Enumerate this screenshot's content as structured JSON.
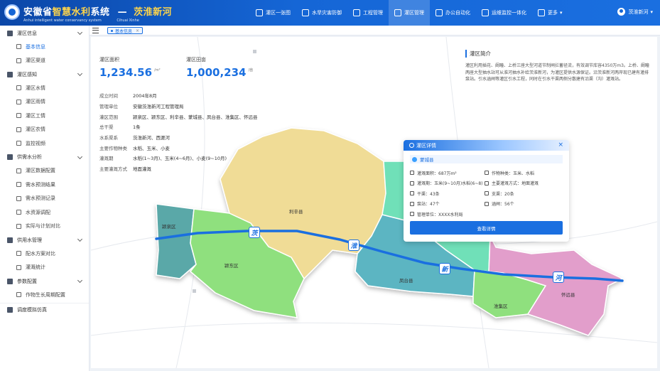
{
  "header": {
    "title_prefix": "安徽省",
    "title_accent": "智慧水利",
    "title_suffix": "系统",
    "project": "茨淮新河",
    "subtitle_en": "Anhui intelligent water conservancy system",
    "subtitle_py": "Cihuai Xinhe",
    "nav": [
      {
        "label": "灌区一张图",
        "icon": "map-icon"
      },
      {
        "label": "水旱灾害防御",
        "icon": "shield-icon"
      },
      {
        "label": "工程管理",
        "icon": "chart-icon"
      },
      {
        "label": "灌区管理",
        "icon": "grid-icon",
        "active": true
      },
      {
        "label": "办公自动化",
        "icon": "monitor-icon"
      },
      {
        "label": "运维监控一体化",
        "icon": "gauge-icon"
      },
      {
        "label": "更多",
        "icon": "more-icon"
      }
    ],
    "user": "茨淮新河"
  },
  "sidebar": {
    "groups": [
      {
        "label": "灌区信息",
        "items": [
          "基本信息",
          "灌区渠道"
        ]
      },
      {
        "label": "灌区感知",
        "items": [
          "灌区水情",
          "灌区雨情",
          "灌区工情",
          "灌区农情",
          "监控视频"
        ]
      },
      {
        "label": "供需水分析",
        "items": [
          "灌区数据配置",
          "需水预测结果",
          "需水预测记录",
          "水资源调配",
          "实际与计划对比"
        ]
      },
      {
        "label": "供用水管理",
        "items": [
          "配水方案对比",
          "灌溉统计"
        ]
      },
      {
        "label": "参数配置",
        "items": [
          "作物生长周期配置"
        ]
      },
      {
        "label": "调度模拟仿真",
        "items": []
      }
    ]
  },
  "tabs": [
    {
      "label": "基本信息"
    }
  ],
  "stats": {
    "area_label": "灌区面积",
    "area_value": "1,234.56",
    "area_unit": "/m²",
    "field_label": "灌区田亩",
    "field_value": "1,000,234",
    "field_unit": "/亩"
  },
  "info": [
    {
      "k": "成立时间",
      "v": "2004年8月"
    },
    {
      "k": "管理单位",
      "v": "安徽茨淮新河工程管理局"
    },
    {
      "k": "灌区范围",
      "v": "颍泉区、颍东区、利辛县、蒙城县、凤台县、淮集区、怀远县"
    },
    {
      "k": "总干渠",
      "v": "1条"
    },
    {
      "k": "水系渠系",
      "v": "茨淮新河、西淝河"
    },
    {
      "k": "主要作物种类",
      "v": "水稻、玉米、小麦"
    },
    {
      "k": "灌溉期",
      "v": "水稻(1~3月)、玉米(4~6月)、小麦(9~10月)"
    },
    {
      "k": "主要灌溉方式",
      "v": "地面灌溉"
    }
  ],
  "intro": {
    "title": "灌区简介",
    "text": "灌区利用插花、阚疃、上桥三座大型河道节制闸拦蓄径流，有效调节库容4350万m3。上桥、阚疃两座大型抽水站可从淮河抽水补给茨淮新河，为灌区提供水源保证。沿茨淮新河两岸现已建有灌排泵站。引水涵闸等灌区引水工程，同时在引水干渠两侧分散建有沿渠（沟）灌溉站。"
  },
  "map": {
    "regions": [
      "颍泉区",
      "颍东区",
      "利辛县",
      "凤台县",
      "淮集区",
      "怀远县"
    ],
    "river_chars": [
      "茨",
      "淮",
      "新",
      "河"
    ],
    "colors": {
      "yingquan": "#5aa8a8",
      "yingdong": "#8fe07e",
      "lixin": "#f0dc96",
      "fengtai": "#5bb5c2",
      "mengcheng": "#6fe0b8",
      "huaiji": "#8fe07e",
      "huaiyuan": "#e29ecb",
      "river": "#1a6fe0"
    }
  },
  "popup": {
    "title": "灌区详情",
    "county": "蒙城县",
    "rows": [
      {
        "l": "灌溉面积：687万m²",
        "r": "作物种类：玉米、水稻"
      },
      {
        "l": "灌溉期：玉米(9~10月)水稻(6~8)",
        "r": "主要灌溉方式：地面灌溉"
      },
      {
        "l": "干渠：43条",
        "r": "支渠：20条"
      },
      {
        "l": "泵站：47个",
        "r": "涵闸：56个"
      },
      {
        "l": "管理单位：XXXX水利局",
        "r": ""
      }
    ],
    "button": "查看详情"
  }
}
